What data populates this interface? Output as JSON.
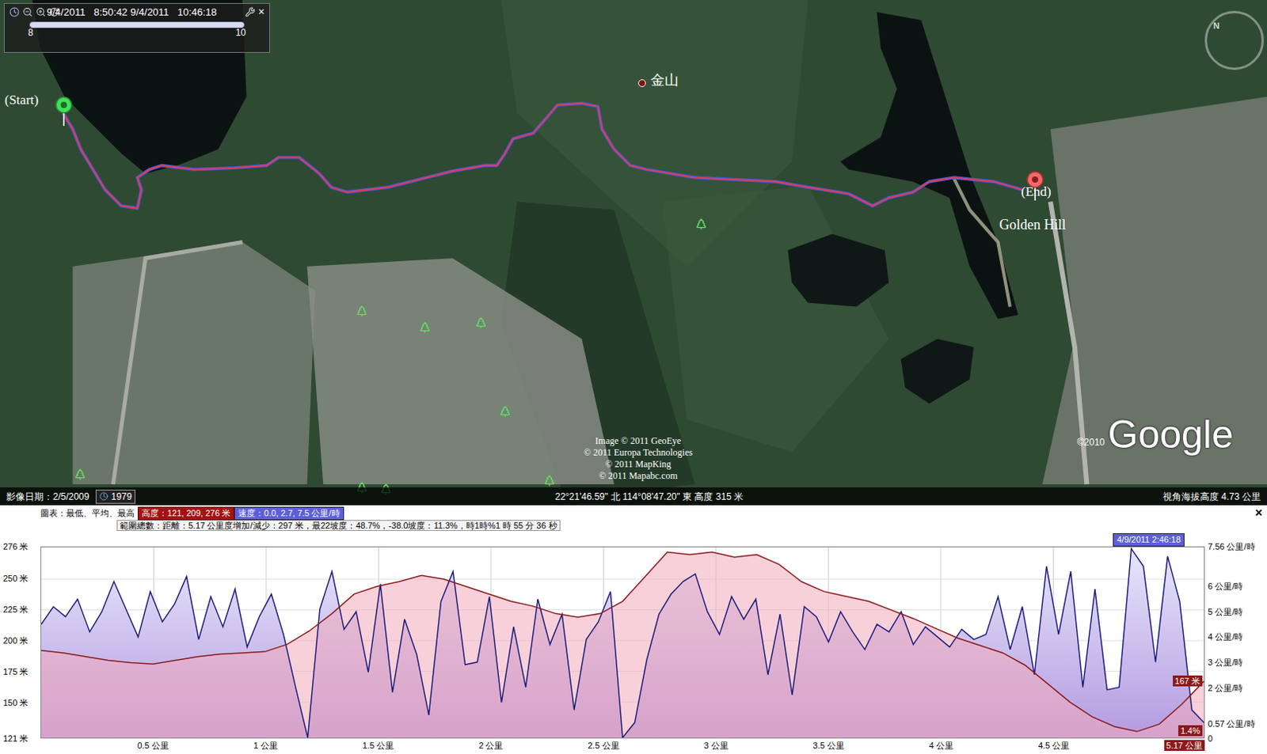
{
  "time_control": {
    "range": "9/4/2011   8:50:42 9/4/2011   10:46:18",
    "start_tick": "8",
    "end_tick": "10",
    "close": "×",
    "level": 1
  },
  "map": {
    "start_label": "(Start)",
    "end_label": "(End)",
    "summit_label": "金山",
    "place_label": "Golden Hill",
    "compass": "N",
    "copyright": [
      "Image © 2011 GeoEye",
      "© 2011 Europa Technologies",
      "© 2011 MapKing",
      "© 2011 Mapabc.com"
    ],
    "logo": "Google",
    "logo_year": "©2010"
  },
  "status_bar": {
    "image_date": "影像日期：2/5/2009",
    "history_year": "1979",
    "coordinates": "22°21'46.59\" 北 114°08'47.20\" 東 高度 315 米",
    "eye_altitude": "視角海拔高度 4.73 公里"
  },
  "chart": {
    "legend_label": "圖表：最低、平均、最高",
    "elevation_stats": "高度：121, 209, 276 米",
    "speed_stats": "速度：0.0, 2.7, 7.5 公里/時",
    "summary": "範圍總數：距離：5.17 公里度增加/減少：297 米，最22坡度：48.7%，-38.0坡度：11.3%，時1時%1 時 55 分 36 秒",
    "close": "×",
    "time_badge": "4/9/2011 2:46:18",
    "elevation_badge": "167 米",
    "grade_badge": "1.4%",
    "y_ticks_left": [
      "276 米",
      "250 米",
      "225 米",
      "200 米",
      "175 米",
      "150 米",
      "121 米"
    ],
    "y_ticks_right": [
      "7.56 公里/時",
      "6 公里/時",
      "5 公里/時",
      "4 公里/時",
      "3 公里/時",
      "2 公里/時",
      "0.57 公里/時",
      "0"
    ],
    "x_ticks": [
      "0.5 公里",
      "1 公里",
      "1.5 公里",
      "2 公里",
      "2.5 公里",
      "3 公里",
      "3.5 公里",
      "4 公里",
      "4.5 公里"
    ],
    "x_end": "5.17 公里",
    "elevation": [
      192,
      190,
      187,
      184,
      182,
      181,
      184,
      187,
      189,
      190,
      191,
      197,
      208,
      222,
      238,
      244,
      248,
      253,
      250,
      244,
      238,
      232,
      228,
      222,
      219,
      222,
      232,
      252,
      272,
      270,
      272,
      268,
      270,
      262,
      248,
      240,
      236,
      232,
      225,
      218,
      210,
      202,
      196,
      190,
      180,
      165,
      150,
      138,
      130,
      126,
      132,
      148,
      167
    ],
    "speed": [
      4.5,
      5.2,
      4.8,
      5.5,
      4.2,
      5.0,
      6.2,
      5.1,
      4.0,
      5.8,
      4.6,
      5.3,
      6.4,
      3.9,
      5.6,
      4.4,
      5.9,
      3.6,
      4.8,
      5.7,
      4.1,
      2.0,
      0.0,
      5.1,
      6.6,
      4.3,
      5.0,
      2.6,
      6.1,
      1.8,
      4.7,
      3.3,
      0.9,
      5.4,
      6.6,
      2.9,
      3.0,
      5.6,
      1.4,
      4.4,
      2.0,
      5.5,
      3.7,
      4.9,
      1.1,
      3.9,
      4.6,
      5.8,
      0.0,
      0.6,
      3.1,
      4.9,
      5.7,
      6.2,
      6.5,
      5.0,
      4.1,
      5.6,
      4.7,
      5.5,
      2.5,
      4.9,
      1.7,
      5.2,
      4.8,
      3.8,
      5.0,
      4.2,
      3.5,
      4.5,
      4.2,
      5.0,
      3.7,
      4.4,
      4.0,
      3.6,
      4.3,
      3.9,
      4.1,
      5.6,
      3.5,
      5.2,
      2.5,
      6.8,
      4.1,
      6.6,
      2.0,
      5.9,
      1.9,
      2.0,
      7.5,
      6.8,
      3.0,
      7.2,
      5.4,
      1.1,
      0.6
    ]
  }
}
